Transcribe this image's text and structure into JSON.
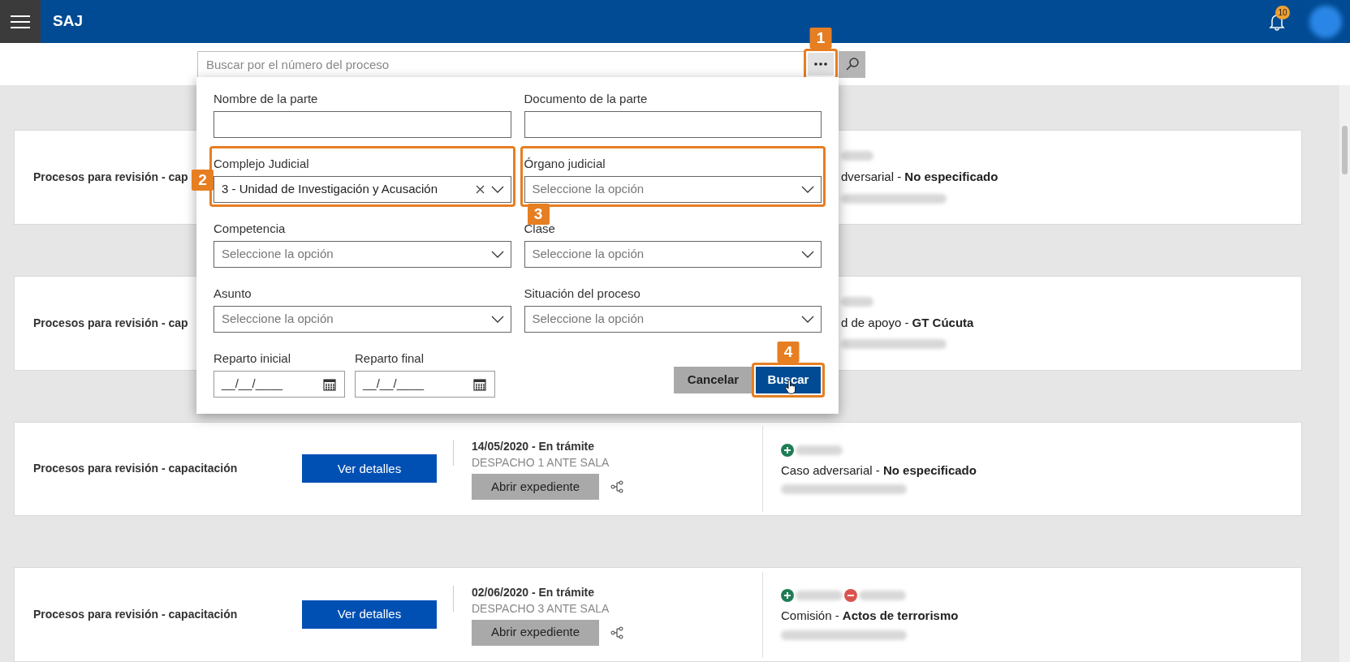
{
  "header": {
    "title": "SAJ",
    "notifications": "10"
  },
  "search": {
    "placeholder": "Buscar por el número del proceso",
    "more_button": {
      "callout": "1"
    }
  },
  "filter_form": {
    "fields": [
      {
        "label": "Nombre de la parte",
        "kind": "text"
      },
      {
        "label": "Documento de la parte",
        "kind": "text"
      },
      {
        "label": "Complejo Judicial",
        "kind": "select",
        "value": "3 - Unidad de Investigación y Acusación",
        "clearable": true,
        "callout": "2"
      },
      {
        "label": "Órgano judicial",
        "kind": "select",
        "placeholder": "Seleccione la opción",
        "callout": "3"
      },
      {
        "label": "Competencia",
        "kind": "select",
        "placeholder": "Seleccione la opción"
      },
      {
        "label": "Clase",
        "kind": "select",
        "placeholder": "Seleccione la opción"
      },
      {
        "label": "Asunto",
        "kind": "select",
        "placeholder": "Seleccione la opción"
      },
      {
        "label": "Situación del proceso",
        "kind": "select",
        "placeholder": "Seleccione la opción"
      },
      {
        "label": "Reparto inicial",
        "kind": "date",
        "placeholder": "__/__/____"
      },
      {
        "label": "Reparto final",
        "kind": "date",
        "placeholder": "__/__/____"
      }
    ],
    "buttons": [
      {
        "label": "Cancelar",
        "kind": "secondary",
        "hovered": false
      },
      {
        "label": "Buscar",
        "kind": "primary",
        "hovered": true,
        "callout": "4"
      }
    ]
  },
  "cards": [
    {
      "kind": "partial",
      "title": "Procesos para revisión - cap",
      "type_line": "dversarial - **No especificado**"
    },
    {
      "kind": "partial",
      "title": "Procesos para revisión - cap",
      "type_line": "d de apoyo - **GT Cúcuta**"
    },
    {
      "kind": "full",
      "title": "Procesos para revisión - capacitación",
      "details_button": "Ver detalles",
      "date_status": "14/05/2020 - En trámite",
      "office": "DESPACHO 1 ANTE SALA",
      "open_button": "Abrir expediente",
      "parties": [
        {
          "kind": "plus"
        }
      ],
      "type_line": "Caso adversarial - **No especificado**"
    },
    {
      "kind": "full",
      "title": "Procesos para revisión - capacitación",
      "details_button": "Ver detalles",
      "date_status": "02/06/2020 - En trámite",
      "office": "DESPACHO 3 ANTE SALA",
      "open_button": "Abrir expediente",
      "parties": [
        {
          "kind": "plus"
        },
        {
          "kind": "minus"
        }
      ],
      "type_line": "Comisión - **Actos de terrorismo**"
    }
  ]
}
